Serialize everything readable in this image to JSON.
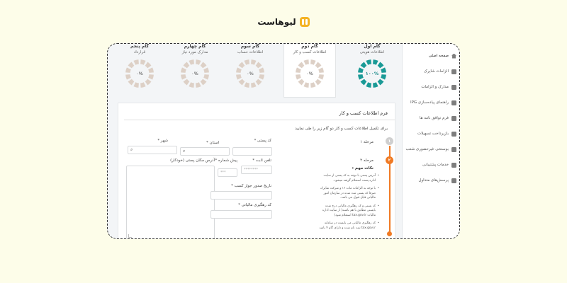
{
  "brand": {
    "name": "لیوهاست"
  },
  "sidebar": {
    "items": [
      {
        "label": "صفحه اصلی",
        "icon": "home-icon"
      },
      {
        "label": "الزامات شاپرک",
        "icon": "document-icon"
      },
      {
        "label": "مدارک و الزامات",
        "icon": "folder-icon"
      },
      {
        "label": "راهنمای پیاده‌سازی IPG",
        "icon": "guide-icon"
      },
      {
        "label": "فرم توافق نامه ها",
        "icon": "contract-icon"
      },
      {
        "label": "بازپرداخت تسهیلات",
        "icon": "card-icon"
      },
      {
        "label": "بوستخی غیرحضوری شعب",
        "icon": "check-icon"
      },
      {
        "label": "خدمات پشتیبانی",
        "icon": "mail-icon"
      },
      {
        "label": "پرسش‌های متداول",
        "icon": "chat-icon"
      }
    ]
  },
  "steps": [
    {
      "tab": "گام پنجم",
      "title": "قرارداد",
      "value": "۰%",
      "progress": 0
    },
    {
      "tab": "گام چهارم",
      "title": "مدارک مورد نیاز",
      "value": "۰%",
      "progress": 0
    },
    {
      "tab": "گام سوم",
      "title": "اطلاعات حساب",
      "value": "۰%",
      "progress": 0
    },
    {
      "tab": "گام دوم",
      "title": "اطلاعات کسب و کار",
      "value": "۰%",
      "progress": 0
    },
    {
      "tab": "گام اول",
      "title": "اطلاعات هویتی",
      "value": "۱۰۰%",
      "progress": 1
    }
  ],
  "colors": {
    "ring_empty": "#ddd0c6",
    "ring_done": "#1a9a96",
    "accent": "#f07a24"
  },
  "form": {
    "title": "فرم اطلاعات کسب و کار",
    "description": "برای تکمیل اطلاعات کسب و کار دو گام زیر را طی نمایید",
    "stage1": "مرحله ۱",
    "stage2": "مرحله ۲",
    "stage1_num": "۱",
    "stage2_num": "۲",
    "notes_title": "نکات مهم :",
    "notes": [
      "آدرس پستی با توجه به کد پستی از سایت اداره پست استعلام گرفته میشود.",
      "با توجه به الزامات ماده ۱۶ و شرکت شاپرک صرفا کد پستی ثبت شده در سازمان امور مالیاتی قابل قبول می باشد.",
      "کد پستی و کد رهگیری مالیاتی درج شده بایستی مطابق با هم باشند( از سایت اداره مالیات tax.gov.ir استعلام شود)",
      "کد رهگیری مالیاتی می بایست در سامانه tax.gov.ir ثبت نام شده و دارای گام ۴ باشد"
    ],
    "fields": {
      "postal_code": "کد پستی *",
      "province": "استان *",
      "city": "شهر *",
      "phone": "تلفن ثابت *",
      "area_code": "پیش شماره *",
      "address": "آدرس مکان پستی (خودکار)",
      "license_date": "تاریخ صدور جواز کسب *",
      "tax_code": "کد رهگیری مالیاتی *",
      "phone_placeholder": "********",
      "area_placeholder": "***"
    }
  }
}
